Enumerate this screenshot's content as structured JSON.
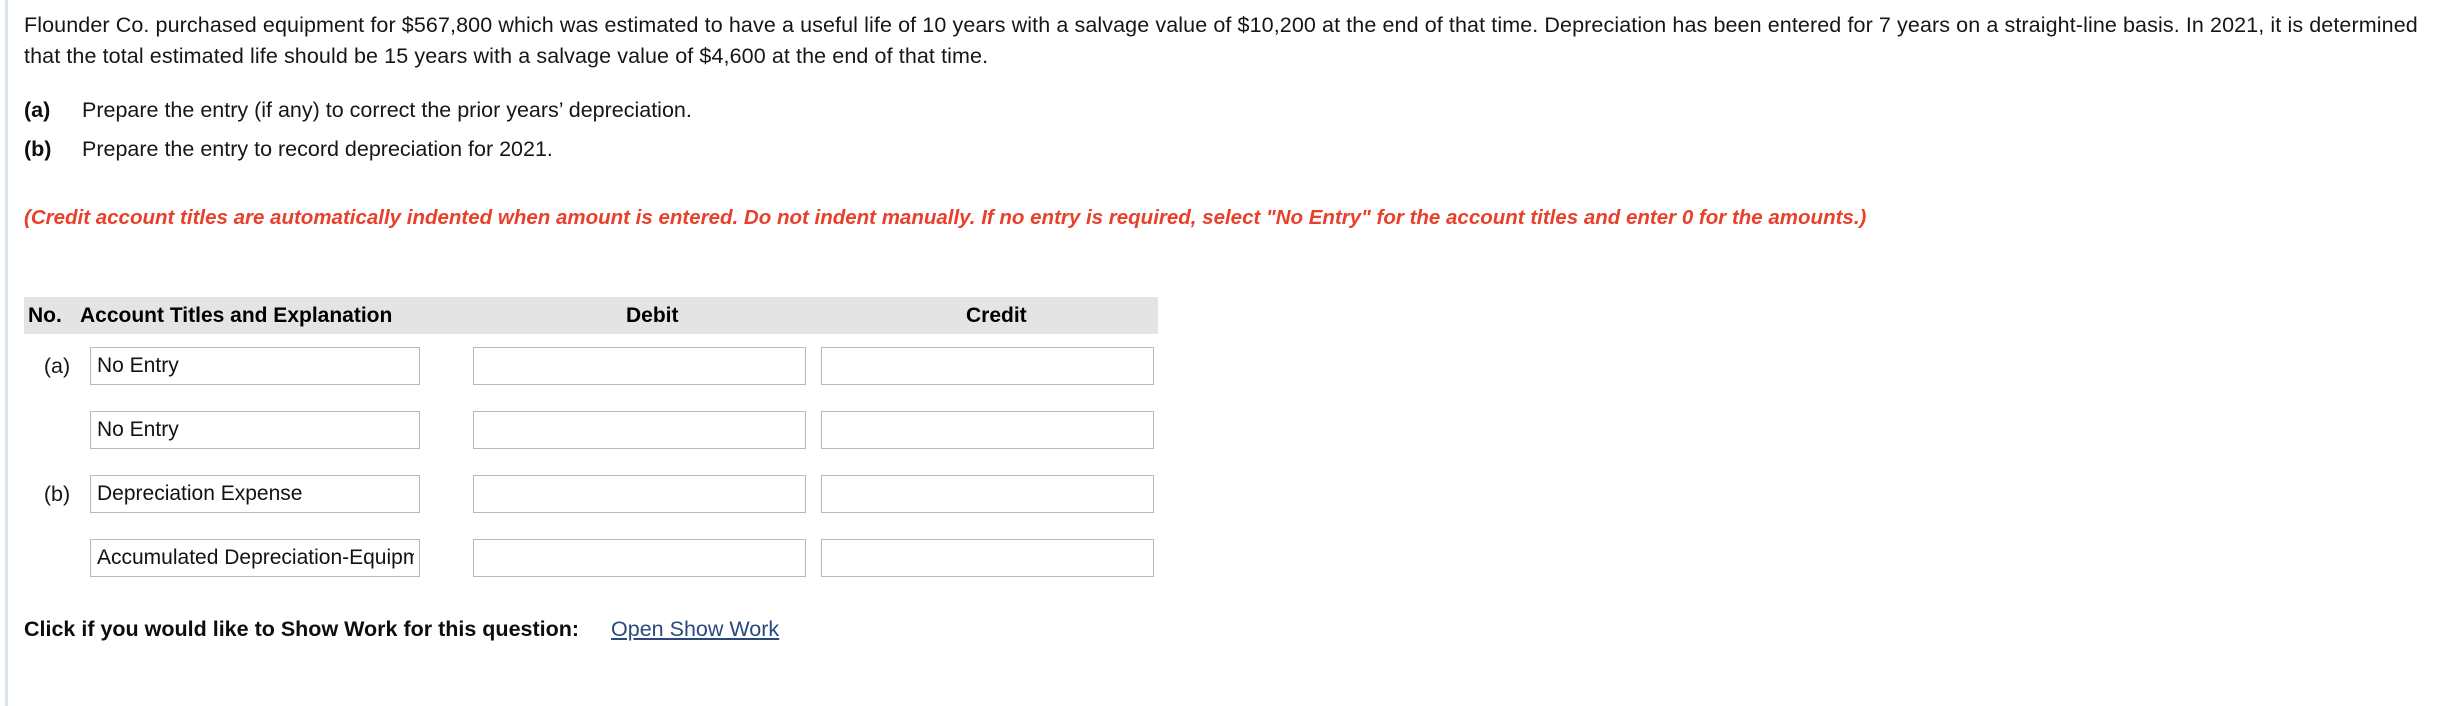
{
  "problem": {
    "text": "Flounder Co. purchased equipment for $567,800 which was estimated to have a useful life of 10 years with a salvage value of $10,200 at the end of that time. Depreciation has been entered for 7 years on a straight-line basis. In 2021, it is determined that the total estimated life should be 15 years with a salvage value of $4,600 at the end of that time."
  },
  "requirements": [
    {
      "letter": "(a)",
      "text": "Prepare the entry (if any) to correct the prior years’ depreciation."
    },
    {
      "letter": "(b)",
      "text": "Prepare the entry to record depreciation for 2021."
    }
  ],
  "note": {
    "text": "(Credit account titles are automatically indented when amount is entered. Do not indent manually. If no entry is required, select \"No Entry\" for the account titles and enter 0 for the amounts.)",
    "color": "#e8402a"
  },
  "journal": {
    "headers": {
      "no": "No.",
      "account": "Account Titles and Explanation",
      "debit": "Debit",
      "credit": "Credit"
    },
    "header_background": "#e4e4e4",
    "rows": [
      {
        "no": "(a)",
        "account": "No Entry",
        "debit": "",
        "credit": ""
      },
      {
        "no": "",
        "account": "No Entry",
        "debit": "",
        "credit": ""
      },
      {
        "no": "(b)",
        "account": "Depreciation Expense",
        "debit": "",
        "credit": ""
      },
      {
        "no": "",
        "account": "Accumulated Depreciation-Equipment",
        "debit": "",
        "credit": ""
      }
    ]
  },
  "show_work": {
    "label": "Click if you would like to Show Work for this question:",
    "link": "Open Show Work",
    "link_color": "#29487d"
  }
}
